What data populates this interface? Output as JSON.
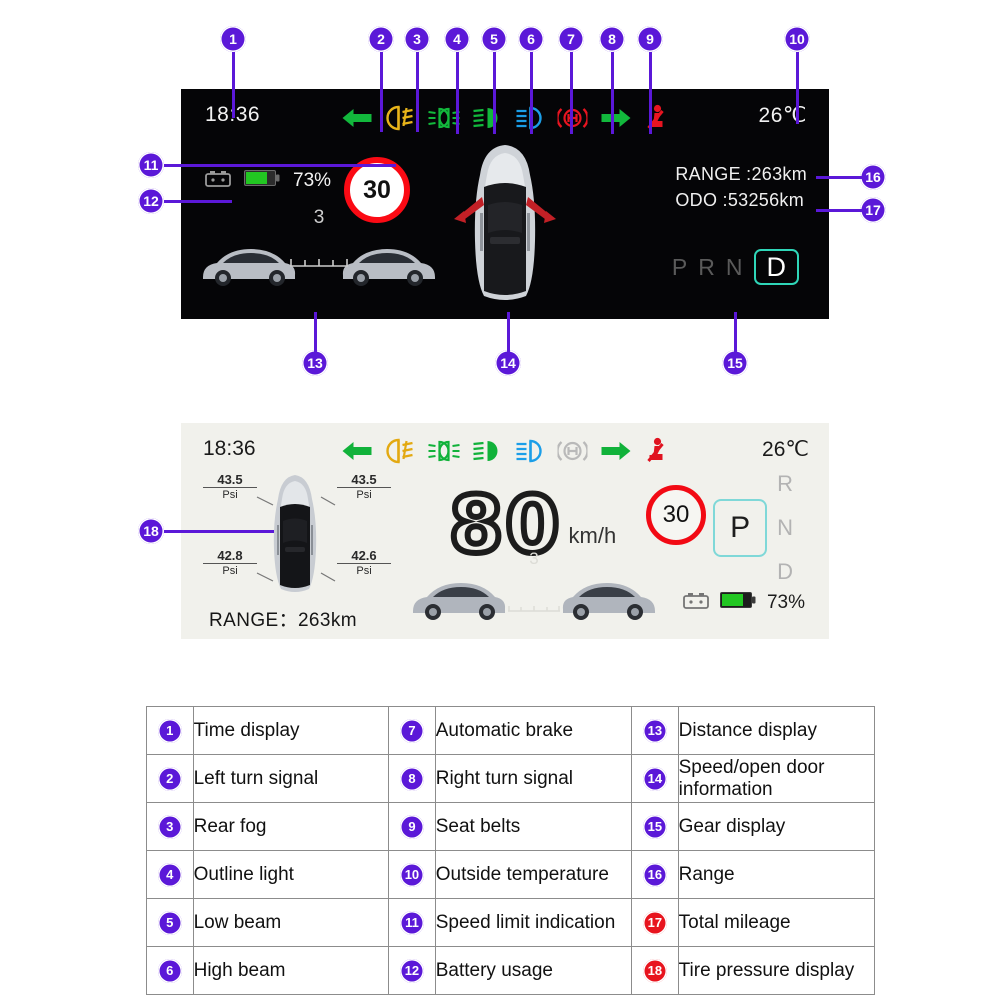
{
  "cluster_dark": {
    "time": "18:36",
    "temperature": "26℃",
    "battery_percent": "73%",
    "speed_limit": "30",
    "range_line": "RANGE :263km",
    "odo_line": "ODO :53256km",
    "distance_value": "3",
    "gears": [
      {
        "label": "P",
        "active": false
      },
      {
        "label": "R",
        "active": false
      },
      {
        "label": "N",
        "active": false
      },
      {
        "label": "D",
        "active": true
      }
    ],
    "icons": [
      {
        "name": "left-turn-signal-icon",
        "color": "#12b83c"
      },
      {
        "name": "rear-fog-icon",
        "color": "#e8b41a"
      },
      {
        "name": "outline-light-icon",
        "color": "#12b83c"
      },
      {
        "name": "low-beam-icon",
        "color": "#12b83c"
      },
      {
        "name": "high-beam-icon",
        "color": "#1b9ee8"
      },
      {
        "name": "automatic-brake-icon",
        "color": "#e81420"
      },
      {
        "name": "right-turn-signal-icon",
        "color": "#12b83c"
      },
      {
        "name": "seat-belt-icon",
        "color": "#e81420"
      }
    ]
  },
  "cluster_light": {
    "time": "18:36",
    "temperature": "26℃",
    "speed": "80",
    "speed_unit": "km/h",
    "speed_limit": "30",
    "range_label": "RANGE：",
    "range_value": "263km",
    "battery_percent": "73%",
    "distance_value": "3",
    "gear_selected": "P",
    "gear_others": [
      "R",
      "N",
      "D"
    ],
    "tire_pressures": [
      {
        "position": "front-left",
        "value": "43.5",
        "unit": "Psi"
      },
      {
        "position": "front-right",
        "value": "43.5",
        "unit": "Psi"
      },
      {
        "position": "rear-left",
        "value": "42.8",
        "unit": "Psi"
      },
      {
        "position": "rear-right",
        "value": "42.6",
        "unit": "Psi"
      }
    ],
    "icons": [
      {
        "name": "left-turn-signal-icon",
        "color": "#11b23a"
      },
      {
        "name": "rear-fog-icon",
        "color": "#e3a911"
      },
      {
        "name": "outline-light-icon",
        "color": "#11b23a"
      },
      {
        "name": "low-beam-icon",
        "color": "#11b23a"
      },
      {
        "name": "high-beam-icon",
        "color": "#1b9ee8"
      },
      {
        "name": "automatic-brake-icon",
        "color": "#b9b9b9"
      },
      {
        "name": "right-turn-signal-icon",
        "color": "#11b23a"
      },
      {
        "name": "seat-belt-icon",
        "color": "#e01320"
      }
    ]
  },
  "callouts": [
    {
      "n": "1"
    },
    {
      "n": "2"
    },
    {
      "n": "3"
    },
    {
      "n": "4"
    },
    {
      "n": "5"
    },
    {
      "n": "6"
    },
    {
      "n": "7"
    },
    {
      "n": "8"
    },
    {
      "n": "9"
    },
    {
      "n": "10"
    },
    {
      "n": "11"
    },
    {
      "n": "12"
    },
    {
      "n": "13"
    },
    {
      "n": "14"
    },
    {
      "n": "15"
    },
    {
      "n": "16"
    },
    {
      "n": "17"
    },
    {
      "n": "18"
    }
  ],
  "legend": {
    "colors": {
      "purple": "#5b18d8",
      "red": "#e8141e"
    },
    "rows": [
      [
        {
          "n": "1",
          "color": "purple",
          "text": "Time display"
        },
        {
          "n": "7",
          "color": "purple",
          "text": "Automatic brake"
        },
        {
          "n": "13",
          "color": "purple",
          "text": "Distance display"
        }
      ],
      [
        {
          "n": "2",
          "color": "purple",
          "text": "Left turn signal"
        },
        {
          "n": "8",
          "color": "purple",
          "text": "Right turn signal"
        },
        {
          "n": "14",
          "color": "purple",
          "text": "Speed/open door information"
        }
      ],
      [
        {
          "n": "3",
          "color": "purple",
          "text": "Rear fog"
        },
        {
          "n": "9",
          "color": "purple",
          "text": "Seat belts"
        },
        {
          "n": "15",
          "color": "purple",
          "text": "Gear display"
        }
      ],
      [
        {
          "n": "4",
          "color": "purple",
          "text": "Outline light"
        },
        {
          "n": "10",
          "color": "purple",
          "text": "Outside temperature"
        },
        {
          "n": "16",
          "color": "purple",
          "text": "Range"
        }
      ],
      [
        {
          "n": "5",
          "color": "purple",
          "text": "Low beam"
        },
        {
          "n": "11",
          "color": "purple",
          "text": "Speed limit indication"
        },
        {
          "n": "17",
          "color": "red",
          "text": "Total mileage"
        }
      ],
      [
        {
          "n": "6",
          "color": "purple",
          "text": "High beam"
        },
        {
          "n": "12",
          "color": "purple",
          "text": "Battery usage"
        },
        {
          "n": "18",
          "color": "red",
          "text": "Tire pressure display"
        }
      ]
    ]
  }
}
